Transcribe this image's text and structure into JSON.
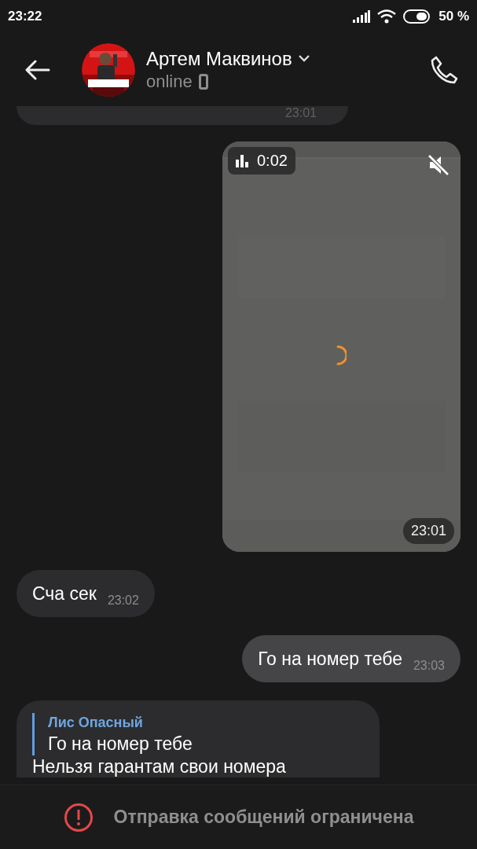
{
  "status_bar": {
    "time": "23:22",
    "battery": "50 %"
  },
  "header": {
    "name": "Артем Маквинов",
    "status": "online"
  },
  "messages": [
    {
      "kind": "stub",
      "outgoing": false,
      "time": "23:01"
    },
    {
      "kind": "video",
      "outgoing": true,
      "duration": "0:02",
      "muted": true,
      "loading": true,
      "time": "23:01"
    },
    {
      "kind": "text",
      "outgoing": false,
      "text": "Сча сек",
      "time": "23:02"
    },
    {
      "kind": "text",
      "outgoing": true,
      "text": "Го на номер тебе",
      "time": "23:03"
    },
    {
      "kind": "reply",
      "outgoing": false,
      "reply_author": "Лис Опасный",
      "reply_text": "Го на номер тебе",
      "text": "Нельзя гарантам свои номера"
    }
  ],
  "notice": {
    "text": "Отправка сообщений ограничена"
  }
}
